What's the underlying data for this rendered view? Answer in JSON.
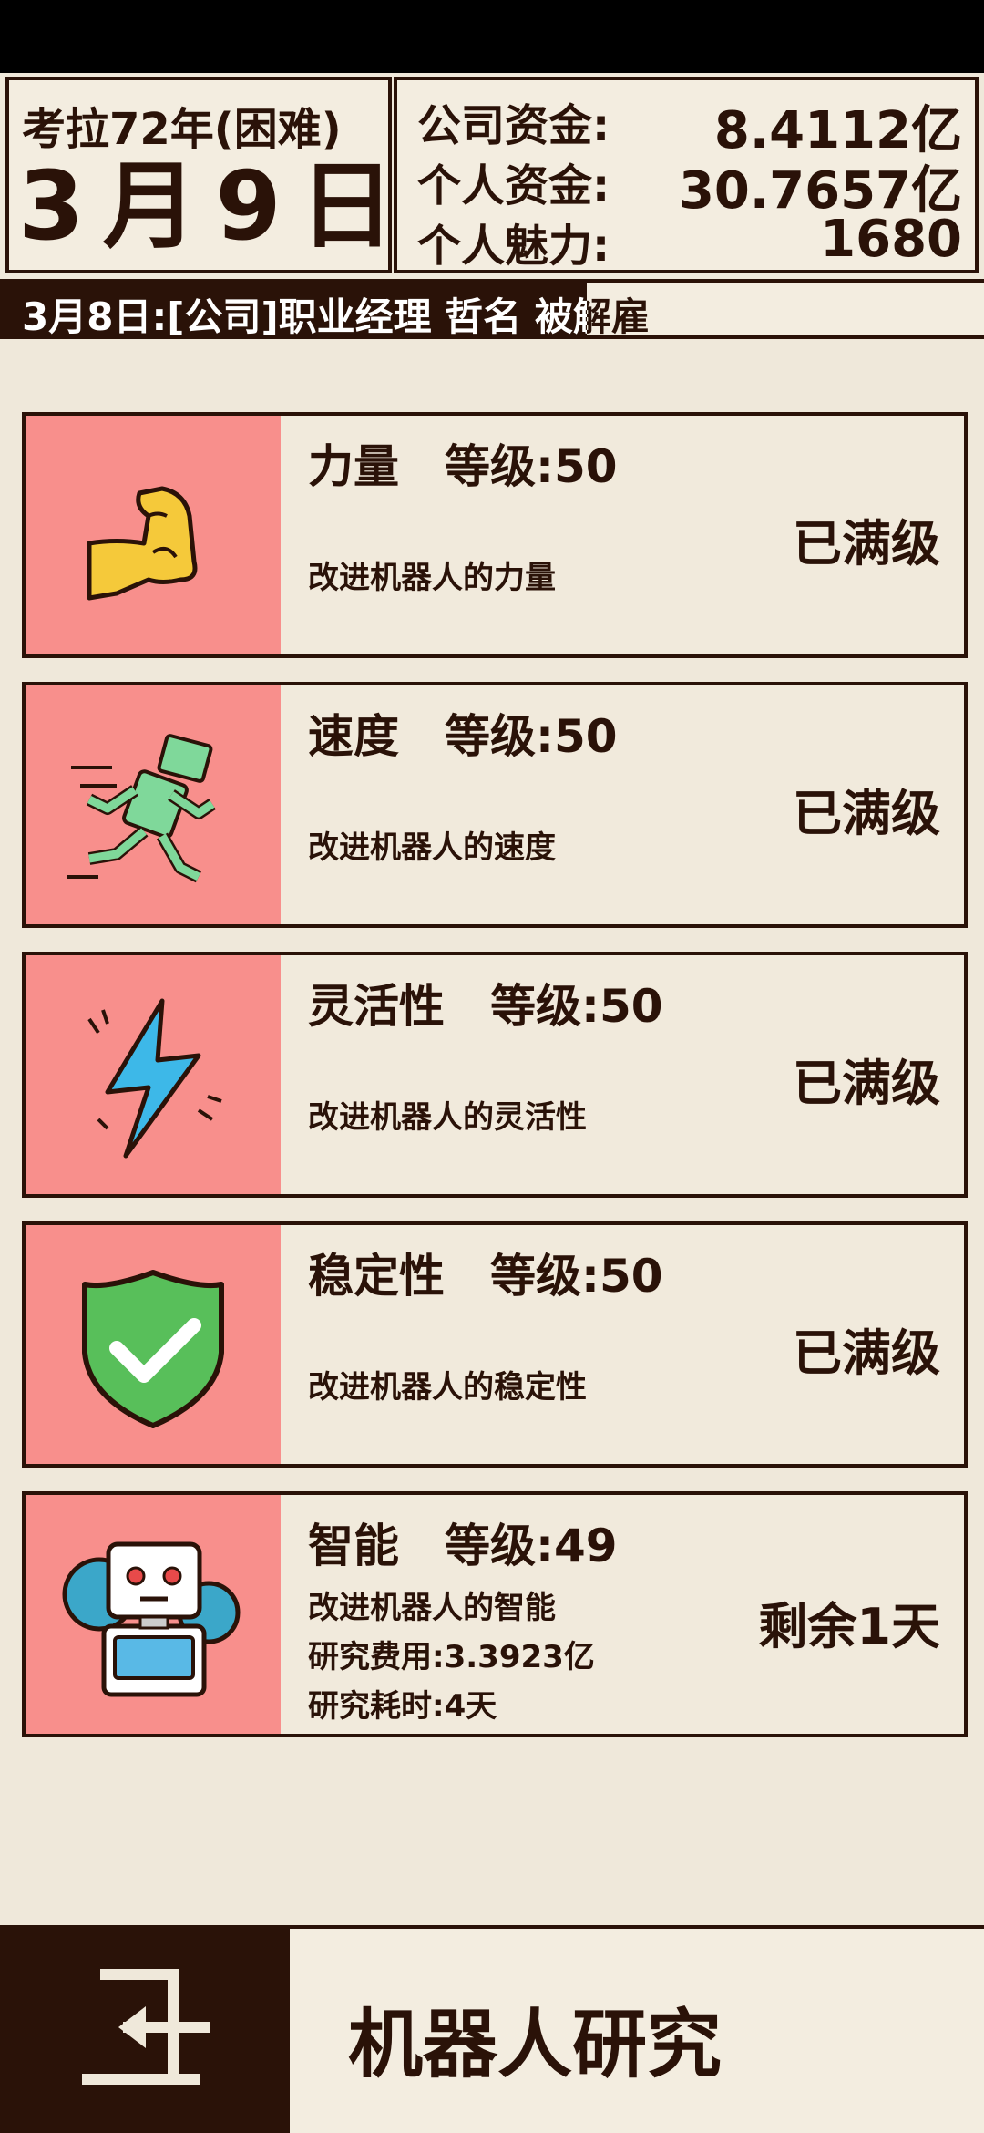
{
  "header": {
    "era": "考拉72年(困难)",
    "date": "3月9日",
    "company_funds_label": "公司资金:",
    "company_funds_value": "8.4112亿",
    "personal_funds_label": "个人资金:",
    "personal_funds_value": "30.7657亿",
    "charm_label": "个人魅力:",
    "charm_value": "1680"
  },
  "ticker": {
    "text": "3月8日:[公司]职业经理 哲名 被解雇"
  },
  "cards": [
    {
      "name": "力量",
      "level": "等级:50",
      "desc": "改进机器人的力量",
      "status": "已满级",
      "icon": "muscle-arm-icon"
    },
    {
      "name": "速度",
      "level": "等级:50",
      "desc": "改进机器人的速度",
      "status": "已满级",
      "icon": "running-robot-icon"
    },
    {
      "name": "灵活性",
      "level": "等级:50",
      "desc": "改进机器人的灵活性",
      "status": "已满级",
      "icon": "lightning-icon"
    },
    {
      "name": "稳定性",
      "level": "等级:50",
      "desc": "改进机器人的稳定性",
      "status": "已满级",
      "icon": "shield-check-icon"
    },
    {
      "name": "智能",
      "level": "等级:49",
      "desc": "改进机器人的智能",
      "cost": "研究费用:3.3923亿",
      "time": "研究耗时:4天",
      "status": "剩余1天",
      "icon": "robot-gear-icon"
    }
  ],
  "footer": {
    "title": "机器人研究",
    "back_icon": "exit-door-icon"
  },
  "colors": {
    "dark_brown": "#2a1208",
    "icon_bg": "#f88f8c",
    "background": "#efe8da"
  }
}
